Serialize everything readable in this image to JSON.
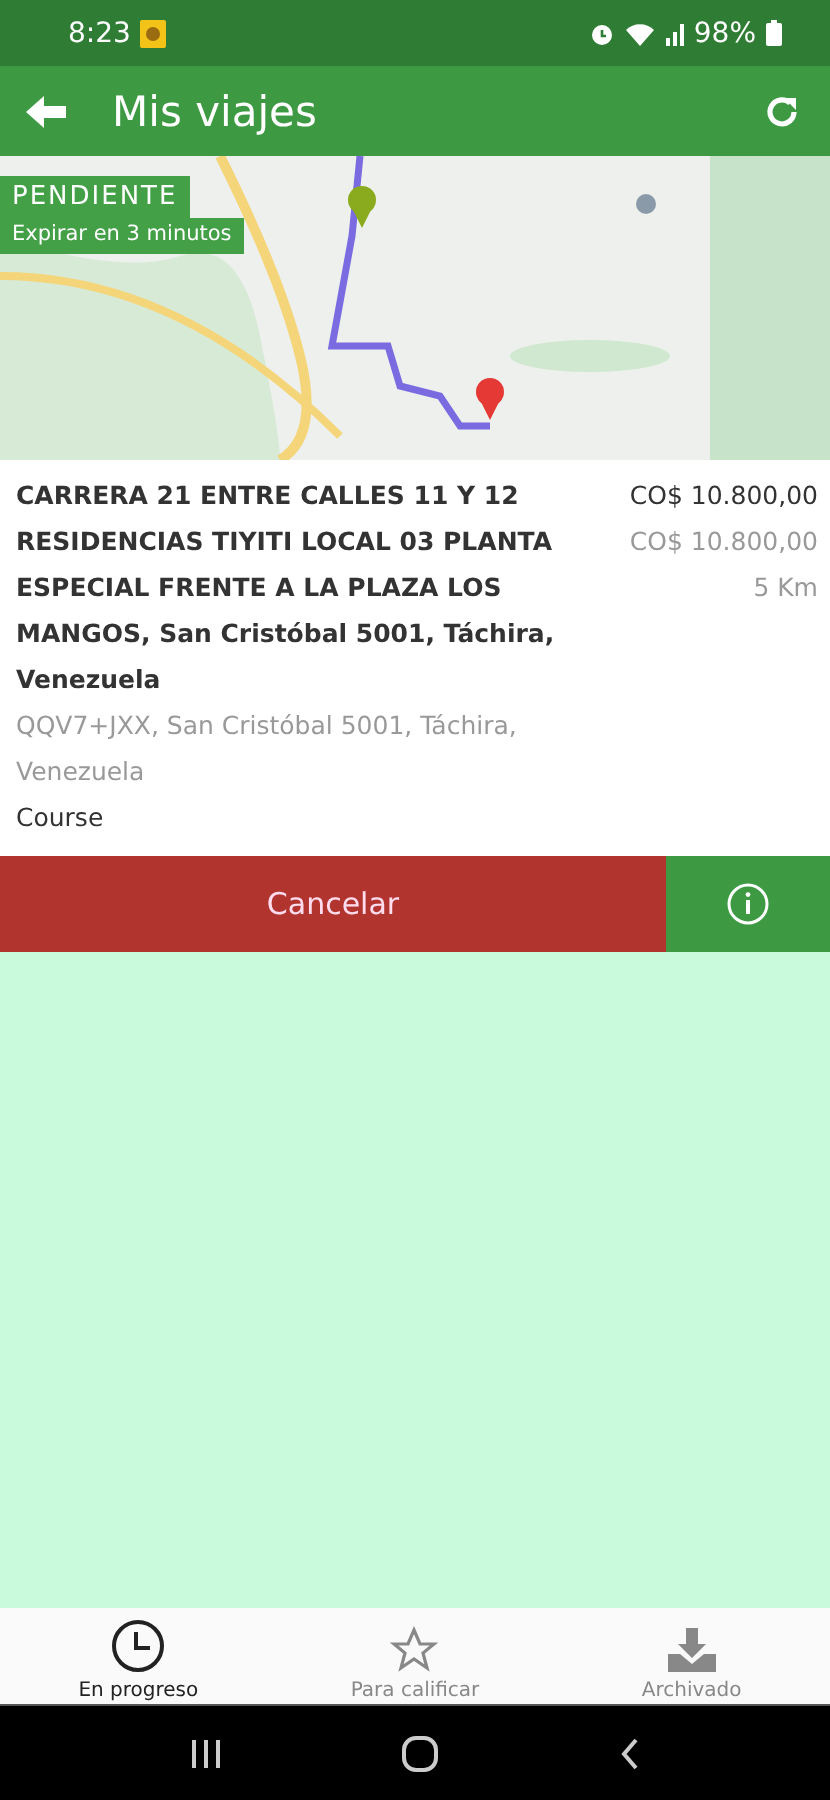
{
  "status_bar": {
    "time": "8:23",
    "battery": "98%"
  },
  "app_bar": {
    "title": "Mis viajes"
  },
  "trip": {
    "status_badge": {
      "label": "PENDIENTE",
      "subtitle": "Expirar en 3 minutos"
    },
    "origin": "CARRERA 21 ENTRE CALLES 11 Y 12 RESIDENCIAS TIYITI LOCAL 03 PLANTA ESPECIAL FRENTE A LA PLAZA LOS MANGOS, San Cristóbal 5001, Táchira, Venezuela",
    "destination": "QQV7+JXX, San Cristóbal 5001, Táchira, Venezuela",
    "type": "Course",
    "price": "CO$ 10.800,00",
    "price_estimate": "CO$ 10.800,00",
    "distance": "5 Km",
    "cancel_button": "Cancelar"
  },
  "bottom_nav": [
    {
      "label": "En progreso",
      "kind": "clock",
      "selected": true
    },
    {
      "label": "Para calificar",
      "kind": "star",
      "selected": false
    },
    {
      "label": "Archivado",
      "kind": "download",
      "selected": false
    }
  ]
}
